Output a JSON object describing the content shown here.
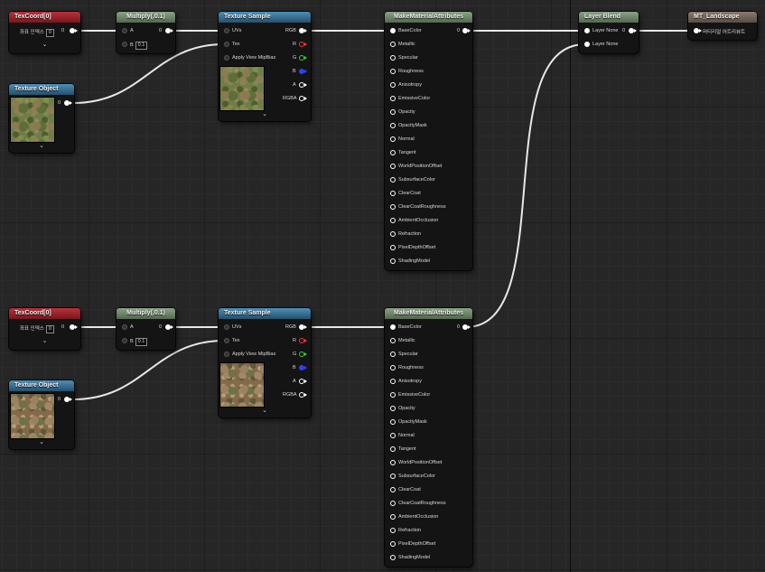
{
  "colors": {
    "wire": "#e8e8e8",
    "pin_r": "#ff3030",
    "pin_g": "#30d030",
    "pin_b": "#3040ff"
  },
  "texcoord": {
    "title": "TexCoord[0]",
    "label": "좌표 인덱스",
    "index": "0",
    "out": "0"
  },
  "multiply": {
    "title": "Multiply(,0.1)",
    "a": "A",
    "b": "B",
    "b_value": "0.1",
    "out": "0"
  },
  "texture_sample": {
    "title": "Texture Sample",
    "uvs": "UVs",
    "tex": "Tex",
    "mip": "Apply View MipBias",
    "rgb": "RGB",
    "r": "R",
    "g": "G",
    "b": "B",
    "a": "A",
    "rgba": "RGBA"
  },
  "texture_object": {
    "title": "Texture Object",
    "out": "0"
  },
  "make_material": {
    "title": "MakeMaterialAttributes",
    "out": "0",
    "pins": [
      "BaseColor",
      "Metallic",
      "Specular",
      "Roughness",
      "Anisotropy",
      "EmissiveColor",
      "Opacity",
      "OpacityMask",
      "Normal",
      "Tangent",
      "WorldPositionOffset",
      "SubsurfaceColor",
      "ClearCoat",
      "ClearCoatRoughness",
      "AmbientOcclusion",
      "Refraction",
      "PixelDepthOffset",
      "ShadingModel"
    ]
  },
  "layer_blend": {
    "title": "Layer Blend",
    "in1": "Layer None",
    "in2": "Layer None",
    "out": "0"
  },
  "landscape": {
    "title": "MT_Landscape",
    "input": "머티리얼 어트리뷰트"
  },
  "icons": {
    "expand": "chevron-down-icon"
  }
}
